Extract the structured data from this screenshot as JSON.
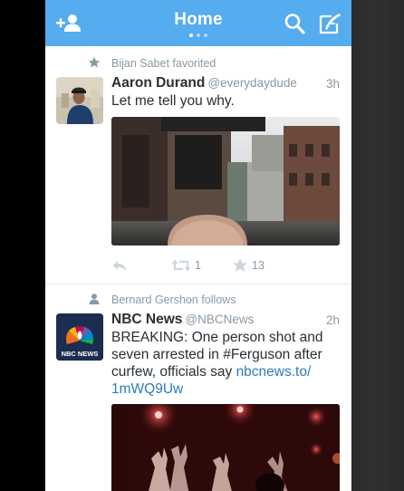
{
  "header": {
    "title": "Home",
    "add_user_icon": "add-user-icon",
    "search_icon": "search-icon",
    "compose_icon": "compose-icon",
    "page_indicator": {
      "pages": 3,
      "active_index": 0
    }
  },
  "tweets": [
    {
      "context_icon": "star-icon",
      "context": "Bijan Sabet favorited",
      "name": "Aaron Durand",
      "handle": "@everydaydude",
      "time": "3h",
      "text": "Let me tell you why.",
      "retweets": "1",
      "favorites": "13"
    },
    {
      "context_icon": "person-icon",
      "context": "Bernard Gershon follows",
      "name": "NBC News",
      "handle": "@NBCNews",
      "time": "2h",
      "text_line1": "BREAKING: One person shot and",
      "text_line2": "seven arrested in #Ferguson after",
      "text_line3": "curfew, officials say",
      "link_part1": "nbcnews.to/",
      "link_part2": "1mWQ9Uw",
      "avatar_logo_text": "NBC NEWS"
    }
  ],
  "colors": {
    "brand": "#55acee",
    "name": "#292f33",
    "secondary": "#8899a6",
    "link": "#2b7bb9"
  }
}
